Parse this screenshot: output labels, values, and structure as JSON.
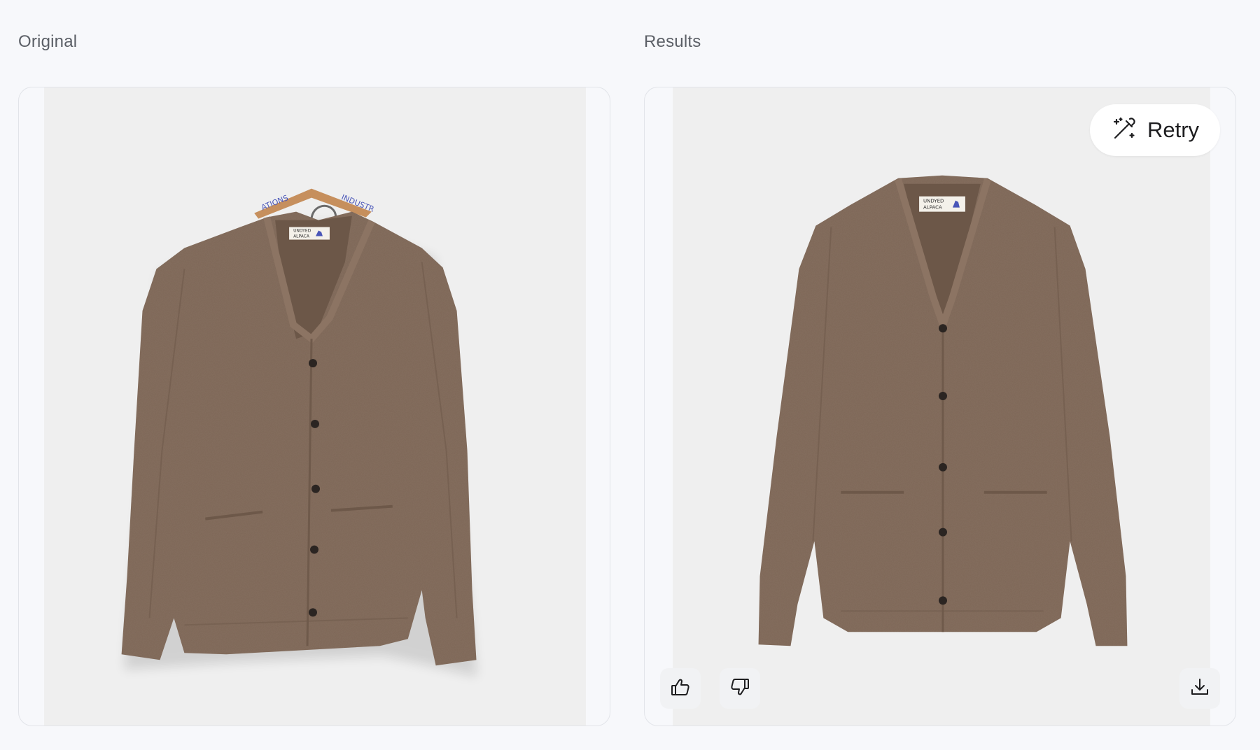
{
  "original": {
    "label": "Original",
    "image_alt": "Brown alpaca cardigan on a wooden hanger",
    "hanger_text_left": "ATIONS",
    "hanger_text_right": "INDUSTR",
    "tag_line1": "UNDYED",
    "tag_line2": "ALPACA"
  },
  "results": {
    "label": "Results",
    "image_alt": "Generated brown alpaca cardigan on plain background",
    "retry_label": "Retry",
    "tag_line1": "UNDYED",
    "tag_line2": "ALPACA"
  },
  "icons": {
    "retry": "magic-wand-icon",
    "like": "thumbs-up-icon",
    "dislike": "thumbs-down-icon",
    "download": "download-icon"
  },
  "colors": {
    "page_bg": "#f7f8fb",
    "photo_bg": "#efefef",
    "sweater": "#7d6656",
    "button_bg": "#ffffff"
  }
}
